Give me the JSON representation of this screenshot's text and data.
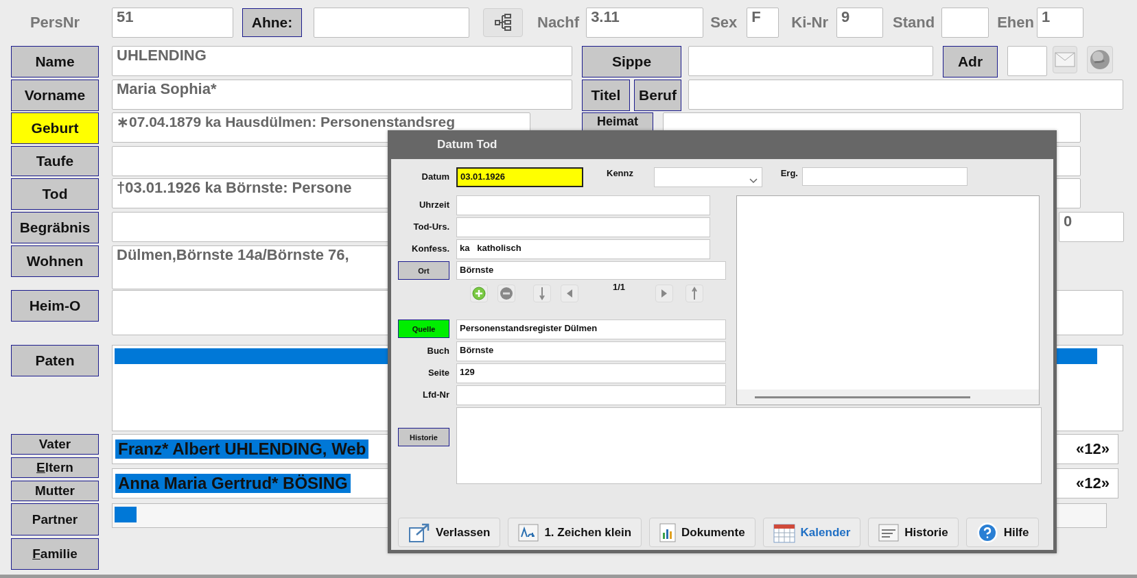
{
  "header": {
    "pers_nr": {
      "label": "PersNr",
      "value": "51"
    },
    "ahne": {
      "label": "Ahne:"
    },
    "nachf": {
      "label": "Nachf",
      "value": "3.11"
    },
    "sex": {
      "label": "Sex",
      "value": "F"
    },
    "ki_nr": {
      "label": "Ki-Nr",
      "value": "9"
    },
    "stand": {
      "label": "Stand"
    },
    "ehen": {
      "label": "Ehen",
      "value": "1"
    }
  },
  "person": [
    {
      "label": "Name",
      "value": "UHLENDING",
      "highlight": false
    },
    {
      "label": "Vorname",
      "value": "Maria Sophia*",
      "highlight": false
    },
    {
      "label": "Geburt",
      "value": "∗07.04.1879 ka Hausdülmen: Personenstandsreg",
      "highlight": true
    },
    {
      "label": "Taufe",
      "highlight": false
    },
    {
      "label": "Tod",
      "value": "†03.01.1926 ka Börnste: Persone",
      "highlight": false
    },
    {
      "label": "Begräbnis",
      "highlight": false
    },
    {
      "label": "Wohnen",
      "value": "Dülmen,Börnste 14a/Börnste 76,",
      "highlight": false
    },
    {
      "label": "Heim-O",
      "highlight": false
    }
  ],
  "extras": {
    "sippe": "Sippe",
    "adr": "Adr",
    "titel": "Titel",
    "beruf": "Beruf",
    "heimat": "Heimat",
    "begraebnis_count": "0"
  },
  "paten": {
    "label": "Paten"
  },
  "parents": [
    {
      "label": "Vater",
      "value": "Franz* Albert UHLENDING, Web",
      "count": "«12»",
      "selected": true
    },
    {
      "label": "Mutter",
      "value": "Anna Maria Gertrud* BÖSING",
      "count": "«12»",
      "selected": true
    }
  ],
  "eltern": {
    "label": "Eltern",
    "accel": true
  },
  "partner": {
    "label": "Partner",
    "accel": false
  },
  "familie": {
    "label": "Familie",
    "accel": true
  },
  "dialog": {
    "title": "Datum Tod",
    "datum": {
      "label": "Datum",
      "value": "03.01.1926"
    },
    "kennz": {
      "label": "Kennz"
    },
    "erg": {
      "label": "Erg."
    },
    "fields": [
      {
        "kind": "label",
        "label": "Uhrzeit"
      },
      {
        "kind": "label",
        "label": "Tod-Urs."
      },
      {
        "kind": "label",
        "label": "Konfess.",
        "value": "ka   katholisch"
      },
      {
        "kind": "button",
        "label": "Ort",
        "value": "Börnste",
        "highlight": false
      }
    ],
    "counter": "1/1",
    "source_fields": [
      {
        "kind": "button",
        "label": "Quelle",
        "value": "Personenstandsregister Dülmen",
        "highlight": true
      },
      {
        "kind": "label",
        "label": "Buch",
        "value": "Börnste"
      },
      {
        "kind": "label",
        "label": "Seite",
        "value": "129"
      },
      {
        "kind": "label",
        "label": "Lfd-Nr"
      }
    ],
    "historie": {
      "label": "Historie"
    },
    "buttons": [
      {
        "kind": "exit",
        "label": "Verlassen",
        "highlight": false
      },
      {
        "kind": "case",
        "label": "1. Zeichen klein",
        "highlight": false
      },
      {
        "kind": "documents",
        "label": "Dokumente",
        "highlight": false
      },
      {
        "kind": "calendar",
        "label": "Kalender",
        "highlight": true
      },
      {
        "kind": "text",
        "label": "Historie",
        "highlight": false
      },
      {
        "kind": "help",
        "label": "Hilfe",
        "highlight": false
      }
    ]
  }
}
